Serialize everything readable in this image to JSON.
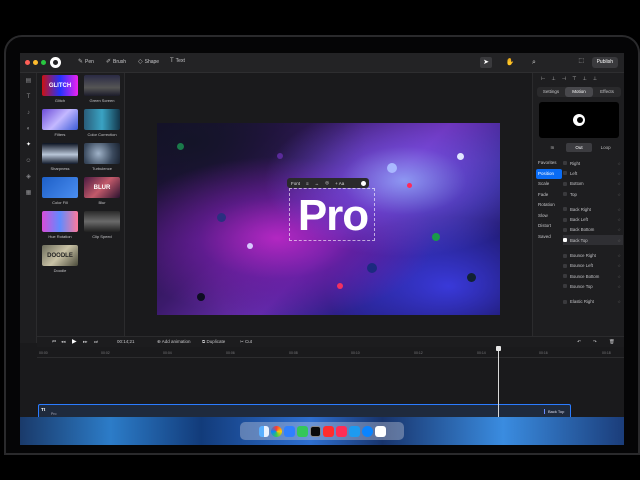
{
  "toolbar": {
    "tools": [
      {
        "label": "Pen",
        "icon": "pen-icon"
      },
      {
        "label": "Brush",
        "icon": "brush-icon"
      },
      {
        "label": "Shape",
        "icon": "shape-icon"
      },
      {
        "label": "Text",
        "icon": "text-icon"
      }
    ],
    "publish_label": "Publish"
  },
  "library": {
    "items": [
      {
        "label": "Glitch",
        "thumb_text": "GLITCH"
      },
      {
        "label": "Green Screen",
        "thumb_text": ""
      },
      {
        "label": "Filters",
        "thumb_text": ""
      },
      {
        "label": "Color Correction",
        "thumb_text": ""
      },
      {
        "label": "Sharpness",
        "thumb_text": ""
      },
      {
        "label": "Turbulence",
        "thumb_text": ""
      },
      {
        "label": "Color Fill",
        "thumb_text": ""
      },
      {
        "label": "Blur",
        "thumb_text": "BLUR"
      },
      {
        "label": "Hue Rotation",
        "thumb_text": ""
      },
      {
        "label": "Clip Speed",
        "thumb_text": ""
      },
      {
        "label": "Doodle",
        "thumb_text": "DOODLE"
      }
    ]
  },
  "canvas": {
    "title_text": "Pro",
    "text_toolbar": {
      "font_label": "Font",
      "size_label": "+ Aa"
    }
  },
  "inspector": {
    "tabs": [
      "Settings",
      "Motion",
      "Effects"
    ],
    "active_tab": "Motion",
    "io_tabs": [
      "In",
      "Out",
      "Loop"
    ],
    "active_io": "Out",
    "categories": [
      "Favorites",
      "Position",
      "Scale",
      "Fade",
      "Rotation",
      "Slow",
      "Distort",
      "Saved"
    ],
    "active_category": "Position",
    "animations": [
      "Right",
      "Left",
      "Bottom",
      "Top",
      "Back Right",
      "Back Left",
      "Back Bottom",
      "Back Top",
      "Bounce Right",
      "Bounce Left",
      "Bounce Bottom",
      "Bounce Top",
      "Elastic Right"
    ],
    "active_animation": "Back Top"
  },
  "controls": {
    "timecode": "00:14;21",
    "add_animation": "Add animation",
    "duplicate": "Duplicate",
    "cut": "Cut"
  },
  "timeline": {
    "ticks": [
      "00:00",
      "00:02",
      "00:04",
      "00:06",
      "00:08",
      "00:10",
      "00:12",
      "00:14",
      "00:16",
      "00:18"
    ],
    "title_clip_label": "Tt",
    "title_clip_sub": "Pro",
    "title_clip_tail": "Back Top",
    "audio_label": "Final Tease (Coming Soon Catlike)",
    "zoom_value": "1.2"
  }
}
